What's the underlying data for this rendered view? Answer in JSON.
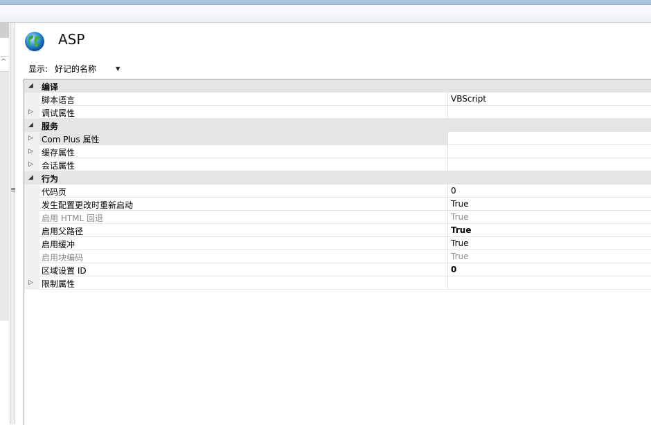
{
  "header": {
    "title": "ASP"
  },
  "display": {
    "label": "显示:",
    "value": "好记的名称"
  },
  "rows": [
    {
      "type": "category",
      "expand": "◢",
      "name": "编译",
      "value": ""
    },
    {
      "type": "property",
      "expand": "",
      "name": "脚本语言",
      "value": "VBScript"
    },
    {
      "type": "property",
      "expand": "▷",
      "name": "调试属性",
      "value": ""
    },
    {
      "type": "category",
      "expand": "◢",
      "name": "服务",
      "value": ""
    },
    {
      "type": "property",
      "expand": "▷",
      "name": "Com Plus 属性",
      "value": "",
      "selected": true
    },
    {
      "type": "property",
      "expand": "▷",
      "name": "缓存属性",
      "value": ""
    },
    {
      "type": "property",
      "expand": "▷",
      "name": "会话属性",
      "value": ""
    },
    {
      "type": "category",
      "expand": "◢",
      "name": "行为",
      "value": ""
    },
    {
      "type": "property",
      "expand": "",
      "name": "代码页",
      "value": "0"
    },
    {
      "type": "property",
      "expand": "",
      "name": "发生配置更改时重新启动",
      "value": "True"
    },
    {
      "type": "property",
      "expand": "",
      "name": "启用 HTML 回退",
      "value": "True",
      "muted": true
    },
    {
      "type": "property",
      "expand": "",
      "name": "启用父路径",
      "value": "True",
      "boldValue": true
    },
    {
      "type": "property",
      "expand": "",
      "name": "启用缓冲",
      "value": "True"
    },
    {
      "type": "property",
      "expand": "",
      "name": "启用块编码",
      "value": "True",
      "muted": true
    },
    {
      "type": "property",
      "expand": "",
      "name": "区域设置 ID",
      "value": "0",
      "boldValue": true
    },
    {
      "type": "property",
      "expand": "▷",
      "name": "限制属性",
      "value": ""
    }
  ]
}
